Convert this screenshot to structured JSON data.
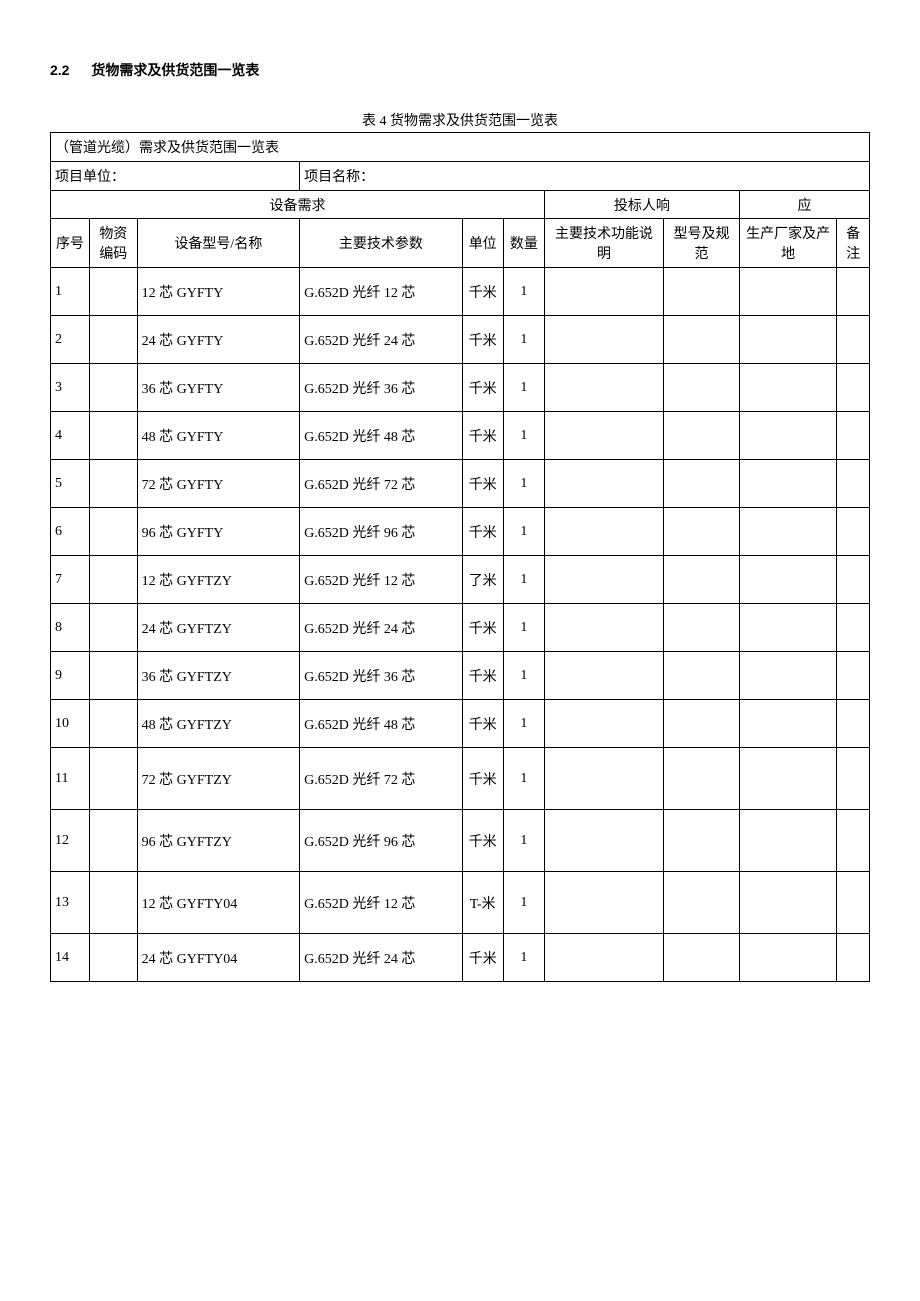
{
  "section": {
    "number": "2.2",
    "title": "货物需求及供货范围一览表"
  },
  "caption": "表 4 货物需求及供货范围一览表",
  "header_rows": {
    "title_row": "（管道光缆）需求及供货范围一览表",
    "proj_unit_label": "项目单位：",
    "proj_name_label": "项目名称：",
    "equip_demand": "设备需求",
    "bidder_resp_1": "投标人响",
    "bidder_resp_2": "应"
  },
  "columns": {
    "seq": "序号",
    "code": "物资编码",
    "model": "设备型号/名称",
    "param": "主要技术参数",
    "unit": "单位",
    "qty": "数量",
    "func": "主要技术功能说明",
    "spec": "型号及规范",
    "maker": "生产厂家及产地",
    "note": "备注"
  },
  "rows": [
    {
      "seq": "1",
      "code": "",
      "model": "12 芯 GYFTY",
      "param": "G.652D 光纤 12 芯",
      "unit": "千米",
      "qty": "1",
      "func": "",
      "spec": "",
      "maker": "",
      "note": ""
    },
    {
      "seq": "2",
      "code": "",
      "model": "24 芯 GYFTY",
      "param": "G.652D 光纤 24 芯",
      "unit": "千米",
      "qty": "1",
      "func": "",
      "spec": "",
      "maker": "",
      "note": ""
    },
    {
      "seq": "3",
      "code": "",
      "model": "36 芯 GYFTY",
      "param": "G.652D 光纤 36 芯",
      "unit": "千米",
      "qty": "1",
      "func": "",
      "spec": "",
      "maker": "",
      "note": ""
    },
    {
      "seq": "4",
      "code": "",
      "model": "48 芯 GYFTY",
      "param": "G.652D 光纤 48 芯",
      "unit": "千米",
      "qty": "1",
      "func": "",
      "spec": "",
      "maker": "",
      "note": ""
    },
    {
      "seq": "5",
      "code": "",
      "model": "72 芯 GYFTY",
      "param": "G.652D 光纤 72 芯",
      "unit": "千米",
      "qty": "1",
      "func": "",
      "spec": "",
      "maker": "",
      "note": ""
    },
    {
      "seq": "6",
      "code": "",
      "model": "96 芯 GYFTY",
      "param": "G.652D 光纤 96 芯",
      "unit": "千米",
      "qty": "1",
      "func": "",
      "spec": "",
      "maker": "",
      "note": ""
    },
    {
      "seq": "7",
      "code": "",
      "model": "12 芯 GYFTZY",
      "param": "G.652D 光纤 12 芯",
      "unit": "了米",
      "qty": "1",
      "func": "",
      "spec": "",
      "maker": "",
      "note": ""
    },
    {
      "seq": "8",
      "code": "",
      "model": "24 芯 GYFTZY",
      "param": "G.652D 光纤 24 芯",
      "unit": "千米",
      "qty": "1",
      "func": "",
      "spec": "",
      "maker": "",
      "note": ""
    },
    {
      "seq": "9",
      "code": "",
      "model": "36 芯 GYFTZY",
      "param": "G.652D 光纤 36 芯",
      "unit": "千米",
      "qty": "1",
      "func": "",
      "spec": "",
      "maker": "",
      "note": ""
    },
    {
      "seq": "10",
      "code": "",
      "model": "48 芯 GYFTZY",
      "param": "G.652D 光纤 48 芯",
      "unit": "千米",
      "qty": "1",
      "func": "",
      "spec": "",
      "maker": "",
      "note": ""
    },
    {
      "seq": "11",
      "code": "",
      "model": "72 芯 GYFTZY",
      "param": "G.652D 光纤 72 芯",
      "unit": "千米",
      "qty": "1",
      "func": "",
      "spec": "",
      "maker": "",
      "note": ""
    },
    {
      "seq": "12",
      "code": "",
      "model": "96 芯 GYFTZY",
      "param": "G.652D 光纤 96 芯",
      "unit": "千米",
      "qty": "1",
      "func": "",
      "spec": "",
      "maker": "",
      "note": ""
    },
    {
      "seq": "13",
      "code": "",
      "model": "12 芯 GYFTY04",
      "param": "G.652D 光纤 12 芯",
      "unit": "T-米",
      "qty": "1",
      "func": "",
      "spec": "",
      "maker": "",
      "note": ""
    },
    {
      "seq": "14",
      "code": "",
      "model": "24 芯 GYFTY04",
      "param": "G.652D 光纤 24 芯",
      "unit": "千米",
      "qty": "1",
      "func": "",
      "spec": "",
      "maker": "",
      "note": ""
    }
  ]
}
